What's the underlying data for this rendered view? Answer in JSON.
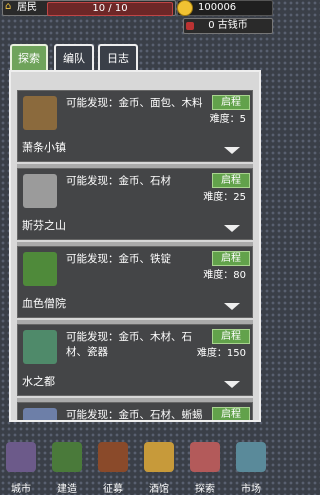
{
  "resources": {
    "population_label": "居民",
    "population_value": "10 / 10",
    "coins_value": "100006",
    "old_coins_value": "0 古钱币"
  },
  "tabs": [
    {
      "label": "探索",
      "active": true
    },
    {
      "label": "编队",
      "active": false
    },
    {
      "label": "日志",
      "active": false
    }
  ],
  "locations": [
    {
      "name": "萧条小镇",
      "finds": "可能发现：金币、面包、木料",
      "difficulty": "难度：5",
      "go_label": "启程",
      "thumb_color": "#8b6a3d"
    },
    {
      "name": "斯芬之山",
      "finds": "可能发现：金币、石材",
      "difficulty": "难度：25",
      "go_label": "启程",
      "thumb_color": "#9b9b9b"
    },
    {
      "name": "血色僧院",
      "finds": "可能发现：金币、铁锭",
      "difficulty": "难度：80",
      "go_label": "启程",
      "thumb_color": "#4f8a3a"
    },
    {
      "name": "水之都",
      "finds": "可能发现：金币、木材、石材、瓷器",
      "difficulty": "难度：150",
      "go_label": "启程",
      "thumb_color": "#4f8a6a"
    },
    {
      "name": "",
      "finds": "可能发现：金币、石材、蜥蜴",
      "difficulty": "",
      "go_label": "启程",
      "thumb_color": "#6d7fa8"
    }
  ],
  "nav": [
    {
      "label": "城市",
      "icon": "city-icon",
      "color": "#6c5a8a"
    },
    {
      "label": "建造",
      "icon": "build-icon",
      "color": "#4a7a3a"
    },
    {
      "label": "征募",
      "icon": "recruit-icon",
      "color": "#8a4a2a"
    },
    {
      "label": "酒馆",
      "icon": "tavern-icon",
      "color": "#c79a3a"
    },
    {
      "label": "探索",
      "icon": "explore-icon",
      "color": "#b35a5a"
    },
    {
      "label": "市场",
      "icon": "market-icon",
      "color": "#5a8a9a"
    }
  ]
}
